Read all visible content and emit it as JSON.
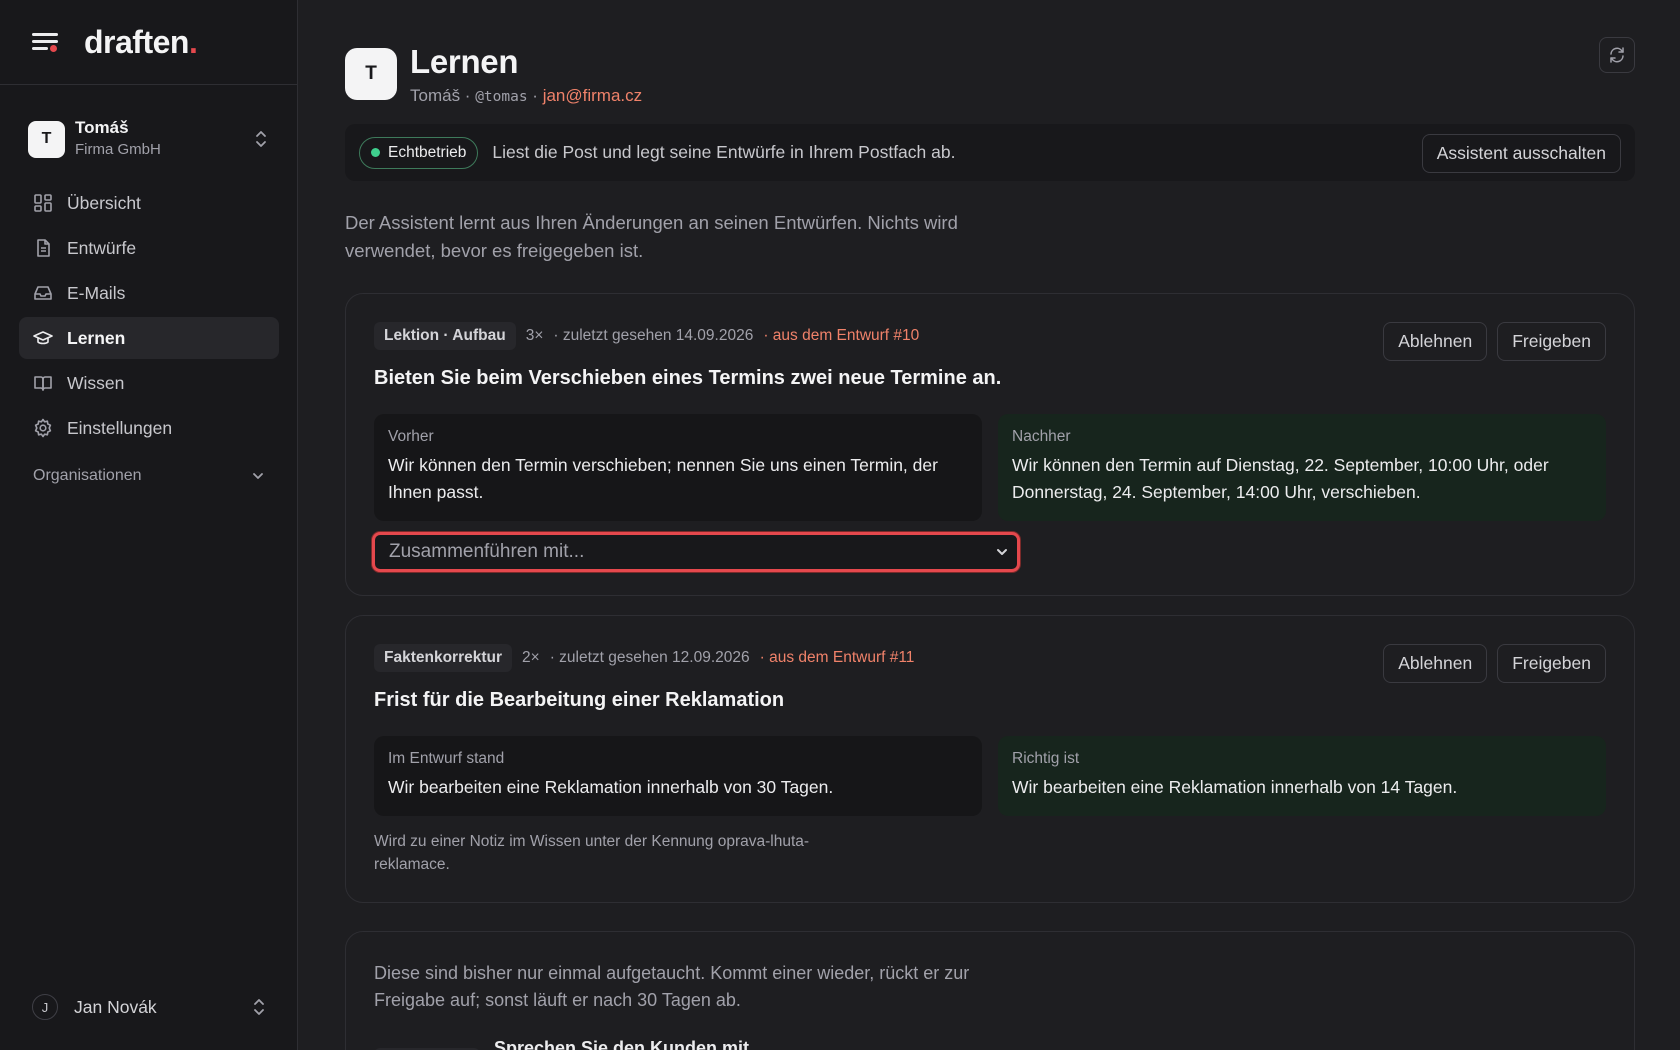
{
  "brand": {
    "name": "draften",
    "dot": "."
  },
  "account": {
    "initial": "T",
    "name": "Tomáš",
    "org": "Firma GmbH"
  },
  "nav": [
    {
      "label": "Übersicht",
      "icon": "dashboard-icon"
    },
    {
      "label": "Entwürfe",
      "icon": "document-icon"
    },
    {
      "label": "E-Mails",
      "icon": "inbox-icon"
    },
    {
      "label": "Lernen",
      "icon": "graduation-cap-icon",
      "active": true
    },
    {
      "label": "Wissen",
      "icon": "book-icon"
    },
    {
      "label": "Einstellungen",
      "icon": "gear-icon"
    }
  ],
  "orgs_label": "Organisationen",
  "user": {
    "initial": "J",
    "name": "Jan Novák"
  },
  "header": {
    "initial": "T",
    "title": "Lernen",
    "sub_name": "Tomáš · ",
    "sub_handle": "@tomas",
    "sub_sep": " · ",
    "sub_email": "jan@firma.cz"
  },
  "status": {
    "badge": "Echtbetrieb",
    "text": "Liest die Post und legt seine Entwürfe in Ihrem Postfach ab.",
    "button": "Assistent ausschalten"
  },
  "intro": "Der Assistent lernt aus Ihren Änderungen an seinen Entwürfen. Nichts wird verwendet, bevor es freigegeben ist.",
  "cards": [
    {
      "tag": "Lektion · Aufbau",
      "count": "3×",
      "seen": "· zuletzt gesehen 14.09.2026",
      "source": "· aus dem Entwurf #10",
      "reject": "Ablehnen",
      "approve": "Freigeben",
      "title": "Bieten Sie beim Verschieben eines Termins zwei neue Termine an.",
      "before_label": "Vorher",
      "before_text": "Wir können den Termin verschieben; nennen Sie uns einen Termin, der Ihnen passt.",
      "after_label": "Nachher",
      "after_text": "Wir können den Termin auf Dienstag, 22. September, 10:00 Uhr, oder Donnerstag, 24. September, 14:00 Uhr, verschieben.",
      "merge_placeholder": "Zusammenführen mit..."
    },
    {
      "tag": "Faktenkorrektur",
      "count": "2×",
      "seen": "· zuletzt gesehen 12.09.2026",
      "source": "· aus dem Entwurf #11",
      "reject": "Ablehnen",
      "approve": "Freigeben",
      "title": "Frist für die Bearbeitung einer Reklamation",
      "before_label": "Im Entwurf stand",
      "before_text": "Wir bearbeiten eine Reklamation innerhalb von 30 Tagen.",
      "after_label": "Richtig ist",
      "after_text": "Wir bearbeiten eine Reklamation innerhalb von 14 Tagen.",
      "note": "Wird zu einer Notiz im Wissen unter der Kennung oprava-lhuta-reklamace."
    }
  ],
  "pending": {
    "text": "Diese sind bisher nur einmal aufgetaucht. Kommt einer wieder, rückt er zur Freigabe auf; sonst läuft er nach 30 Tagen ab.",
    "first_title": "Sprechen Sie den Kunden mit"
  },
  "colors": {
    "accent": "#f0826a",
    "brand_dot": "#e5484d",
    "live": "#3fcf8e",
    "focus_ring": "#e5484d"
  }
}
